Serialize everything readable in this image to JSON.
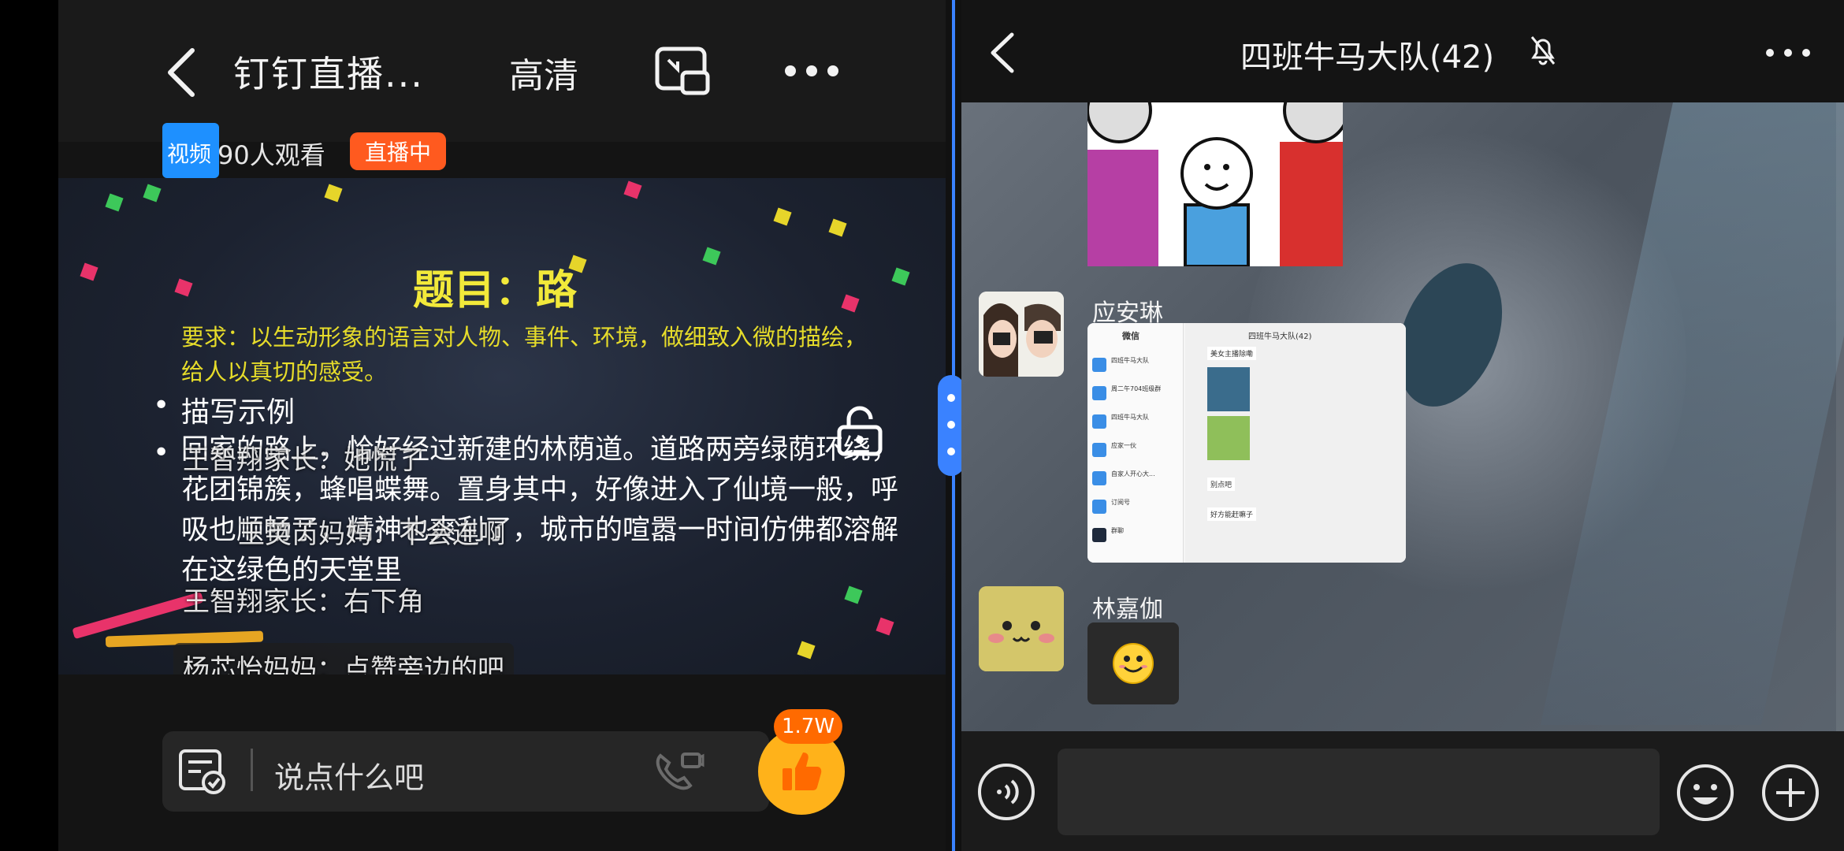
{
  "live": {
    "title": "钉钉直播...",
    "quality": "高清",
    "viewer_prefix": "视频",
    "viewers": "90人观看",
    "status": "直播中",
    "slide": {
      "title": "题目：路",
      "requirement": "要求：以生动形象的语言对人物、事件、环境，做细致入微的描绘，给人以真切的感受。",
      "bullet1": "描写示例",
      "example": "回家的路上，恰好经过新建的林荫道。道路两旁绿荫环绕，花团锦簇，蜂唱蝶舞。置身其中，好像进入了仙境一般，呼吸也顺畅了，精神也爽利了，城市的喧嚣一时间仿佛都溶解在这绿色的天堂里"
    },
    "danmu": [
      "王智翔家长：她慌了",
      "王英芮妈妈：不会连啊",
      "王智翔家长：右下角",
      "杨芯怡妈妈：点赞旁边的吧"
    ],
    "input_placeholder": "说点什么吧",
    "like_count": "1.7W"
  },
  "chat": {
    "title": "四班牛马大队(42)",
    "messages": [
      {
        "sender": "应安琳",
        "type": "image"
      },
      {
        "sender": "林嘉伽",
        "type": "emoji",
        "emoji": "😊"
      }
    ],
    "screenshot": {
      "tab": "微信",
      "group": "四班牛马大队(42)",
      "list": [
        "四班牛马大队",
        "周二午704班级群",
        "四班牛马大队",
        "应家一伙",
        "自家人开心大...",
        "订阅号",
        "群聊"
      ],
      "bubbles": [
        "美女主播除嘞",
        "别点吧",
        "好方能赶嘛子"
      ]
    }
  },
  "colors": {
    "accent_blue": "#3a82ff",
    "live_orange": "#ff5a1f",
    "like_yellow": "#ffb21a",
    "title_yellow": "#f2e93a"
  },
  "icons": [
    "back-icon",
    "pip-icon",
    "more-icon",
    "unlock-icon",
    "notice-icon",
    "call-icon",
    "thumbs-up-icon",
    "mute-bell-icon",
    "voice-icon",
    "emoji-icon",
    "plus-icon"
  ]
}
